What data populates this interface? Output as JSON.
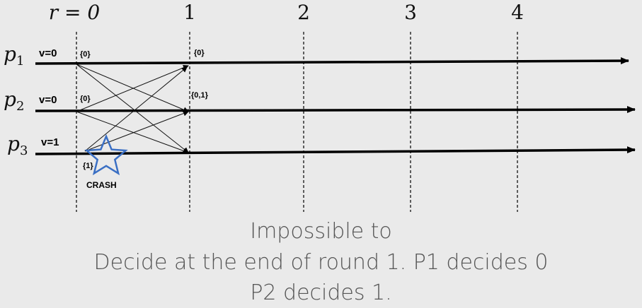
{
  "round_labels": [
    "r = 0",
    "1",
    "2",
    "3",
    "4"
  ],
  "processes": [
    {
      "label": "p",
      "subscript": "1",
      "initial": "v=0",
      "set_start": "{0}",
      "set_round1": "{0}"
    },
    {
      "label": "p",
      "subscript": "2",
      "initial": "v=0",
      "set_start": "{0}",
      "set_round1": "{0,1}"
    },
    {
      "label": "p",
      "subscript": "3",
      "initial": "v=1",
      "set_start": "{1}",
      "set_round1": ""
    }
  ],
  "crash": {
    "label": "CRASH",
    "marker": "star-icon",
    "color": "#3a6fc4"
  },
  "caption": {
    "line1": "Impossible to",
    "line2": "Decide at the end of round 1. P1 decides 0",
    "line3": "P2 decides 1."
  }
}
